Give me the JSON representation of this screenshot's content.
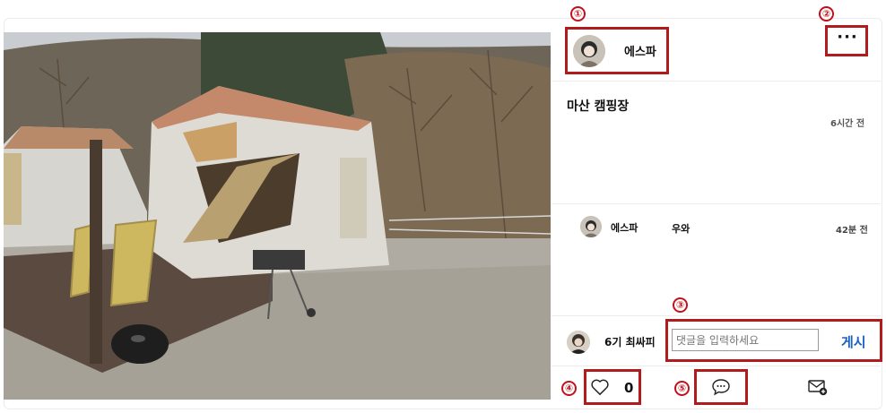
{
  "post": {
    "author": "에스파",
    "more_icon": "more-horizontal-icon",
    "caption": "마산 캠핑장",
    "time_ago": "6시간 전"
  },
  "comments": [
    {
      "author": "에스파",
      "text": "우와",
      "time_ago": "42분 전"
    }
  ],
  "composer": {
    "user": "6기 최싸피",
    "placeholder": "댓글을 입력하세요",
    "submit_label": "게시"
  },
  "actions": {
    "like_icon": "heart-icon",
    "like_count": "0",
    "comment_icon": "chat-bubble-icon",
    "share_icon": "mail-add-icon"
  },
  "annotations": [
    "①",
    "②",
    "③",
    "④",
    "⑤"
  ],
  "colors": {
    "annotation": "#b11b1b",
    "submit": "#1a5fc4"
  }
}
